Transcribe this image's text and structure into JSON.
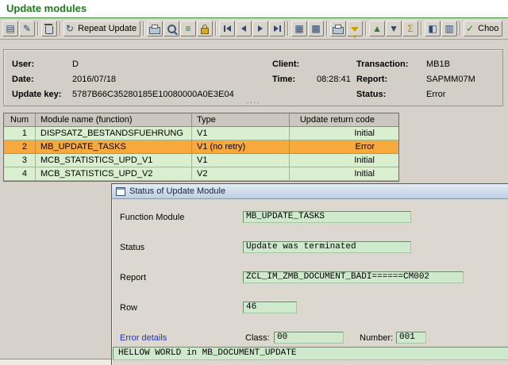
{
  "title": "Update modules",
  "colors": {
    "title_green": "#1e7a1e",
    "selected_row_orange": "#f7a93d",
    "field_green": "#cfe9cd",
    "link_blue": "#1f2fd0"
  },
  "toolbar": {
    "buttons": [
      {
        "name": "display-button",
        "icon": "display-icon",
        "glyph": "▤"
      },
      {
        "name": "change-button",
        "icon": "change-icon",
        "glyph": "✎"
      },
      {
        "name": "delete-button",
        "icon": "trash-icon"
      },
      {
        "name": "repeat-update-button",
        "icon": "repeat-icon",
        "glyph": "↻",
        "label": "Repeat Update"
      },
      {
        "name": "print-button",
        "icon": "printer-icon"
      },
      {
        "name": "find-button",
        "icon": "magnifier-icon"
      },
      {
        "name": "list-button",
        "icon": "list-icon",
        "glyph": "≡"
      },
      {
        "name": "lock-button",
        "icon": "lock-icon"
      },
      {
        "name": "first-page-button",
        "icon": "first-page-icon"
      },
      {
        "name": "previous-page-button",
        "icon": "previous-page-icon"
      },
      {
        "name": "next-page-button",
        "icon": "next-page-icon"
      },
      {
        "name": "last-page-button",
        "icon": "last-page-icon"
      },
      {
        "name": "update-header-button",
        "icon": "table-icon",
        "glyph": "▦"
      },
      {
        "name": "update-modules-button",
        "icon": "table-grid-icon",
        "glyph": "▩"
      },
      {
        "name": "print-list-button",
        "icon": "printer-icon"
      },
      {
        "name": "filter-button",
        "icon": "funnel-icon"
      },
      {
        "name": "sort-ascending-button",
        "icon": "sort-ascending-icon",
        "glyph": "▲"
      },
      {
        "name": "sort-descending-button",
        "icon": "sort-descending-icon",
        "glyph": "▼"
      },
      {
        "name": "sum-button",
        "icon": "sigma-icon",
        "glyph": "Σ"
      },
      {
        "name": "views-button",
        "icon": "views-icon",
        "glyph": "◧"
      },
      {
        "name": "graphic-button",
        "icon": "graphic-icon",
        "glyph": "▥"
      },
      {
        "name": "choose-button",
        "icon": "check-icon",
        "glyph": "✓",
        "label": "Choo"
      }
    ]
  },
  "header": {
    "user_label": "User:",
    "user_value": "D",
    "date_label": "Date:",
    "date_value": "2016/07/18",
    "update_key_label": "Update key:",
    "update_key_value": "5787B66C35280185E10080000A0E3E04",
    "client_label": "Client:",
    "client_value": "",
    "time_label": "Time:",
    "time_value": "08:28:41",
    "transaction_label": "Transaction:",
    "transaction_value": "MB1B",
    "report_label": "Report:",
    "report_value": "SAPMM07M",
    "status_label": "Status:",
    "status_value": "Error",
    "splitter_dots": "····"
  },
  "table": {
    "columns": {
      "num": "Num",
      "module": "Module name (function)",
      "type": "Type",
      "return_code": "Update return code"
    },
    "rows": [
      {
        "num": "1",
        "module": "DISPSATZ_BESTANDSFUEHRUNG",
        "type": "V1",
        "return_code": "Initial",
        "selected": false
      },
      {
        "num": "2",
        "module": "MB_UPDATE_TASKS",
        "type": "V1 (no retry)",
        "return_code": "Error",
        "selected": true
      },
      {
        "num": "3",
        "module": "MCB_STATISTICS_UPD_V1",
        "type": "V1",
        "return_code": "Initial",
        "selected": false
      },
      {
        "num": "4",
        "module": "MCB_STATISTICS_UPD_V2",
        "type": "V2",
        "return_code": "Initial",
        "selected": false
      }
    ]
  },
  "dialog": {
    "title": "Status of Update Module",
    "function_module_label": "Function Module",
    "function_module_value": "MB_UPDATE_TASKS",
    "status_label": "Status",
    "status_value": "Update was terminated",
    "report_label": "Report",
    "report_value": "ZCL_IM_ZMB_DOCUMENT_BADI======CM002",
    "row_label": "Row",
    "row_value": "46",
    "error_details_label": "Error details",
    "class_label": "Class:",
    "class_value": "00",
    "number_label": "Number:",
    "number_value": "001",
    "message": "HELLOW WORLD in MB_DOCUMENT_UPDATE"
  }
}
